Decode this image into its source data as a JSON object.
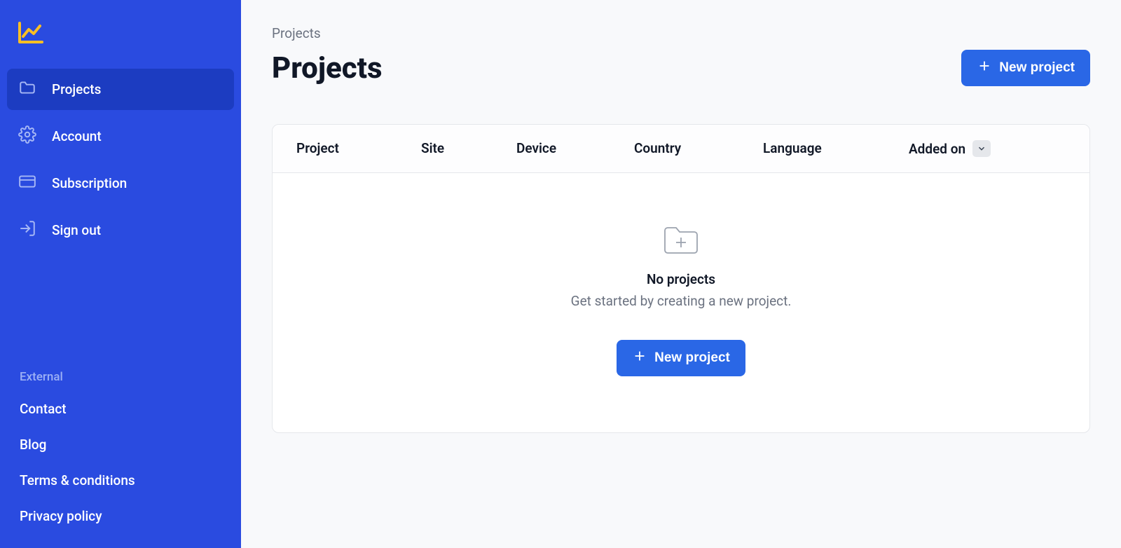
{
  "sidebar": {
    "nav": [
      {
        "label": "Projects"
      },
      {
        "label": "Account"
      },
      {
        "label": "Subscription"
      },
      {
        "label": "Sign out"
      }
    ],
    "external_header": "External",
    "external_links": [
      {
        "label": "Contact"
      },
      {
        "label": "Blog"
      },
      {
        "label": "Terms & conditions"
      },
      {
        "label": "Privacy policy"
      }
    ]
  },
  "main": {
    "breadcrumb": "Projects",
    "page_title": "Projects",
    "new_project_btn": "New project",
    "table": {
      "columns": {
        "project": "Project",
        "site": "Site",
        "device": "Device",
        "country": "Country",
        "language": "Language",
        "added_on": "Added on"
      }
    },
    "empty_state": {
      "title": "No projects",
      "subtitle": "Get started by creating a new project.",
      "cta": "New project"
    }
  }
}
